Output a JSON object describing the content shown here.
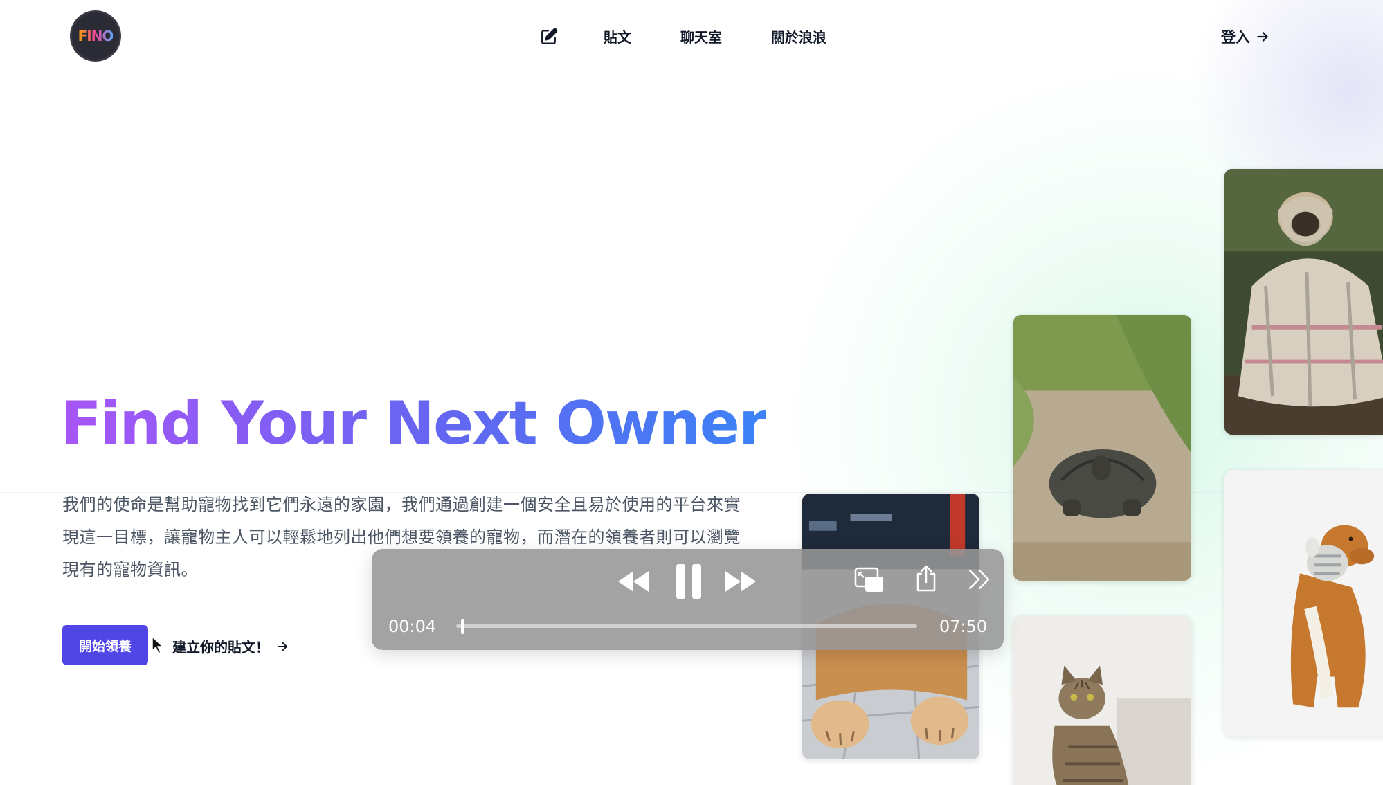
{
  "logo": {
    "text": "FINO"
  },
  "nav": {
    "compose_icon": "edit-icon",
    "items": [
      {
        "label": "貼文"
      },
      {
        "label": "聊天室"
      },
      {
        "label": "關於浪浪"
      }
    ],
    "login_label": "登入"
  },
  "hero": {
    "title": "Find Your Next Owner",
    "description": "我們的使命是幫助寵物找到它們永遠的家園，我們通過創建一個安全且易於使用的平台來實現這一目標，讓寵物主人可以輕鬆地列出他們想要領養的寵物，而潛在的領養者則可以瀏覽現有的寵物資訊。",
    "primary_cta": "開始領養",
    "secondary_cta": "建立你的貼文！"
  },
  "photos": [
    {
      "name": "photo-pug-blanket",
      "subject": "pug wrapped in blanket"
    },
    {
      "name": "photo-tortoise",
      "subject": "tortoise on dirt path"
    },
    {
      "name": "photo-shiba-paws",
      "subject": "dog paws on tiles"
    },
    {
      "name": "photo-retriever-toy",
      "subject": "retriever holding plush toy"
    },
    {
      "name": "photo-tabby-cat",
      "subject": "tabby cat sitting"
    }
  ],
  "player": {
    "current_time": "00:04",
    "total_time": "07:50",
    "progress": 0.01,
    "icons": [
      "rewind-icon",
      "pause-icon",
      "fast-forward-icon",
      "picture-in-picture-icon",
      "share-icon",
      "more-icon"
    ]
  },
  "colors": {
    "primary": "#4f46e5",
    "title_gradient_start": "#a855f7",
    "title_gradient_end": "#3b82f6"
  }
}
